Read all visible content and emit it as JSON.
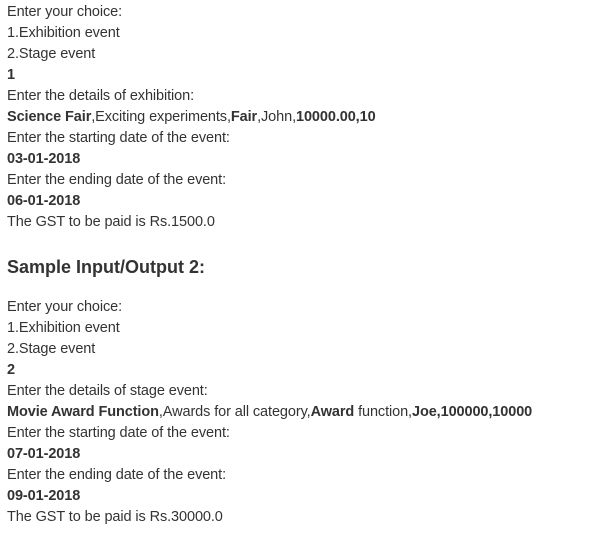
{
  "sample1": {
    "lines": [
      "Enter your choice:",
      "1.Exhibition event",
      "2.Stage event",
      "1",
      "Enter the details of exhibition:"
    ],
    "details": {
      "p1": "Science Fair",
      "p2": ",Exciting experiments,",
      "p3": "Fair",
      "p4": ",John,",
      "p5": "10000.00,10"
    },
    "start_prompt": "Enter the starting date of the event:",
    "start_date": "03-01-2018",
    "end_prompt": "Enter the ending date of the event:",
    "end_date": "06-01-2018",
    "result": "The GST to be paid is Rs.1500.0"
  },
  "heading": "Sample Input/Output 2:",
  "sample2": {
    "lines": [
      "Enter your choice:",
      "1.Exhibition event",
      "2.Stage event",
      "2",
      "Enter the details of stage event:"
    ],
    "details": {
      "p1": "Movie Award Function",
      "p2": ",Awards for all category,",
      "p3": "Award",
      "p4": " function,",
      "p5": "Joe,100000,10000"
    },
    "start_prompt": "Enter the starting date of the event:",
    "start_date": "07-01-2018",
    "end_prompt": "Enter the ending date of the event:",
    "end_date": "09-01-2018",
    "result": "The GST to be paid is Rs.30000.0"
  }
}
